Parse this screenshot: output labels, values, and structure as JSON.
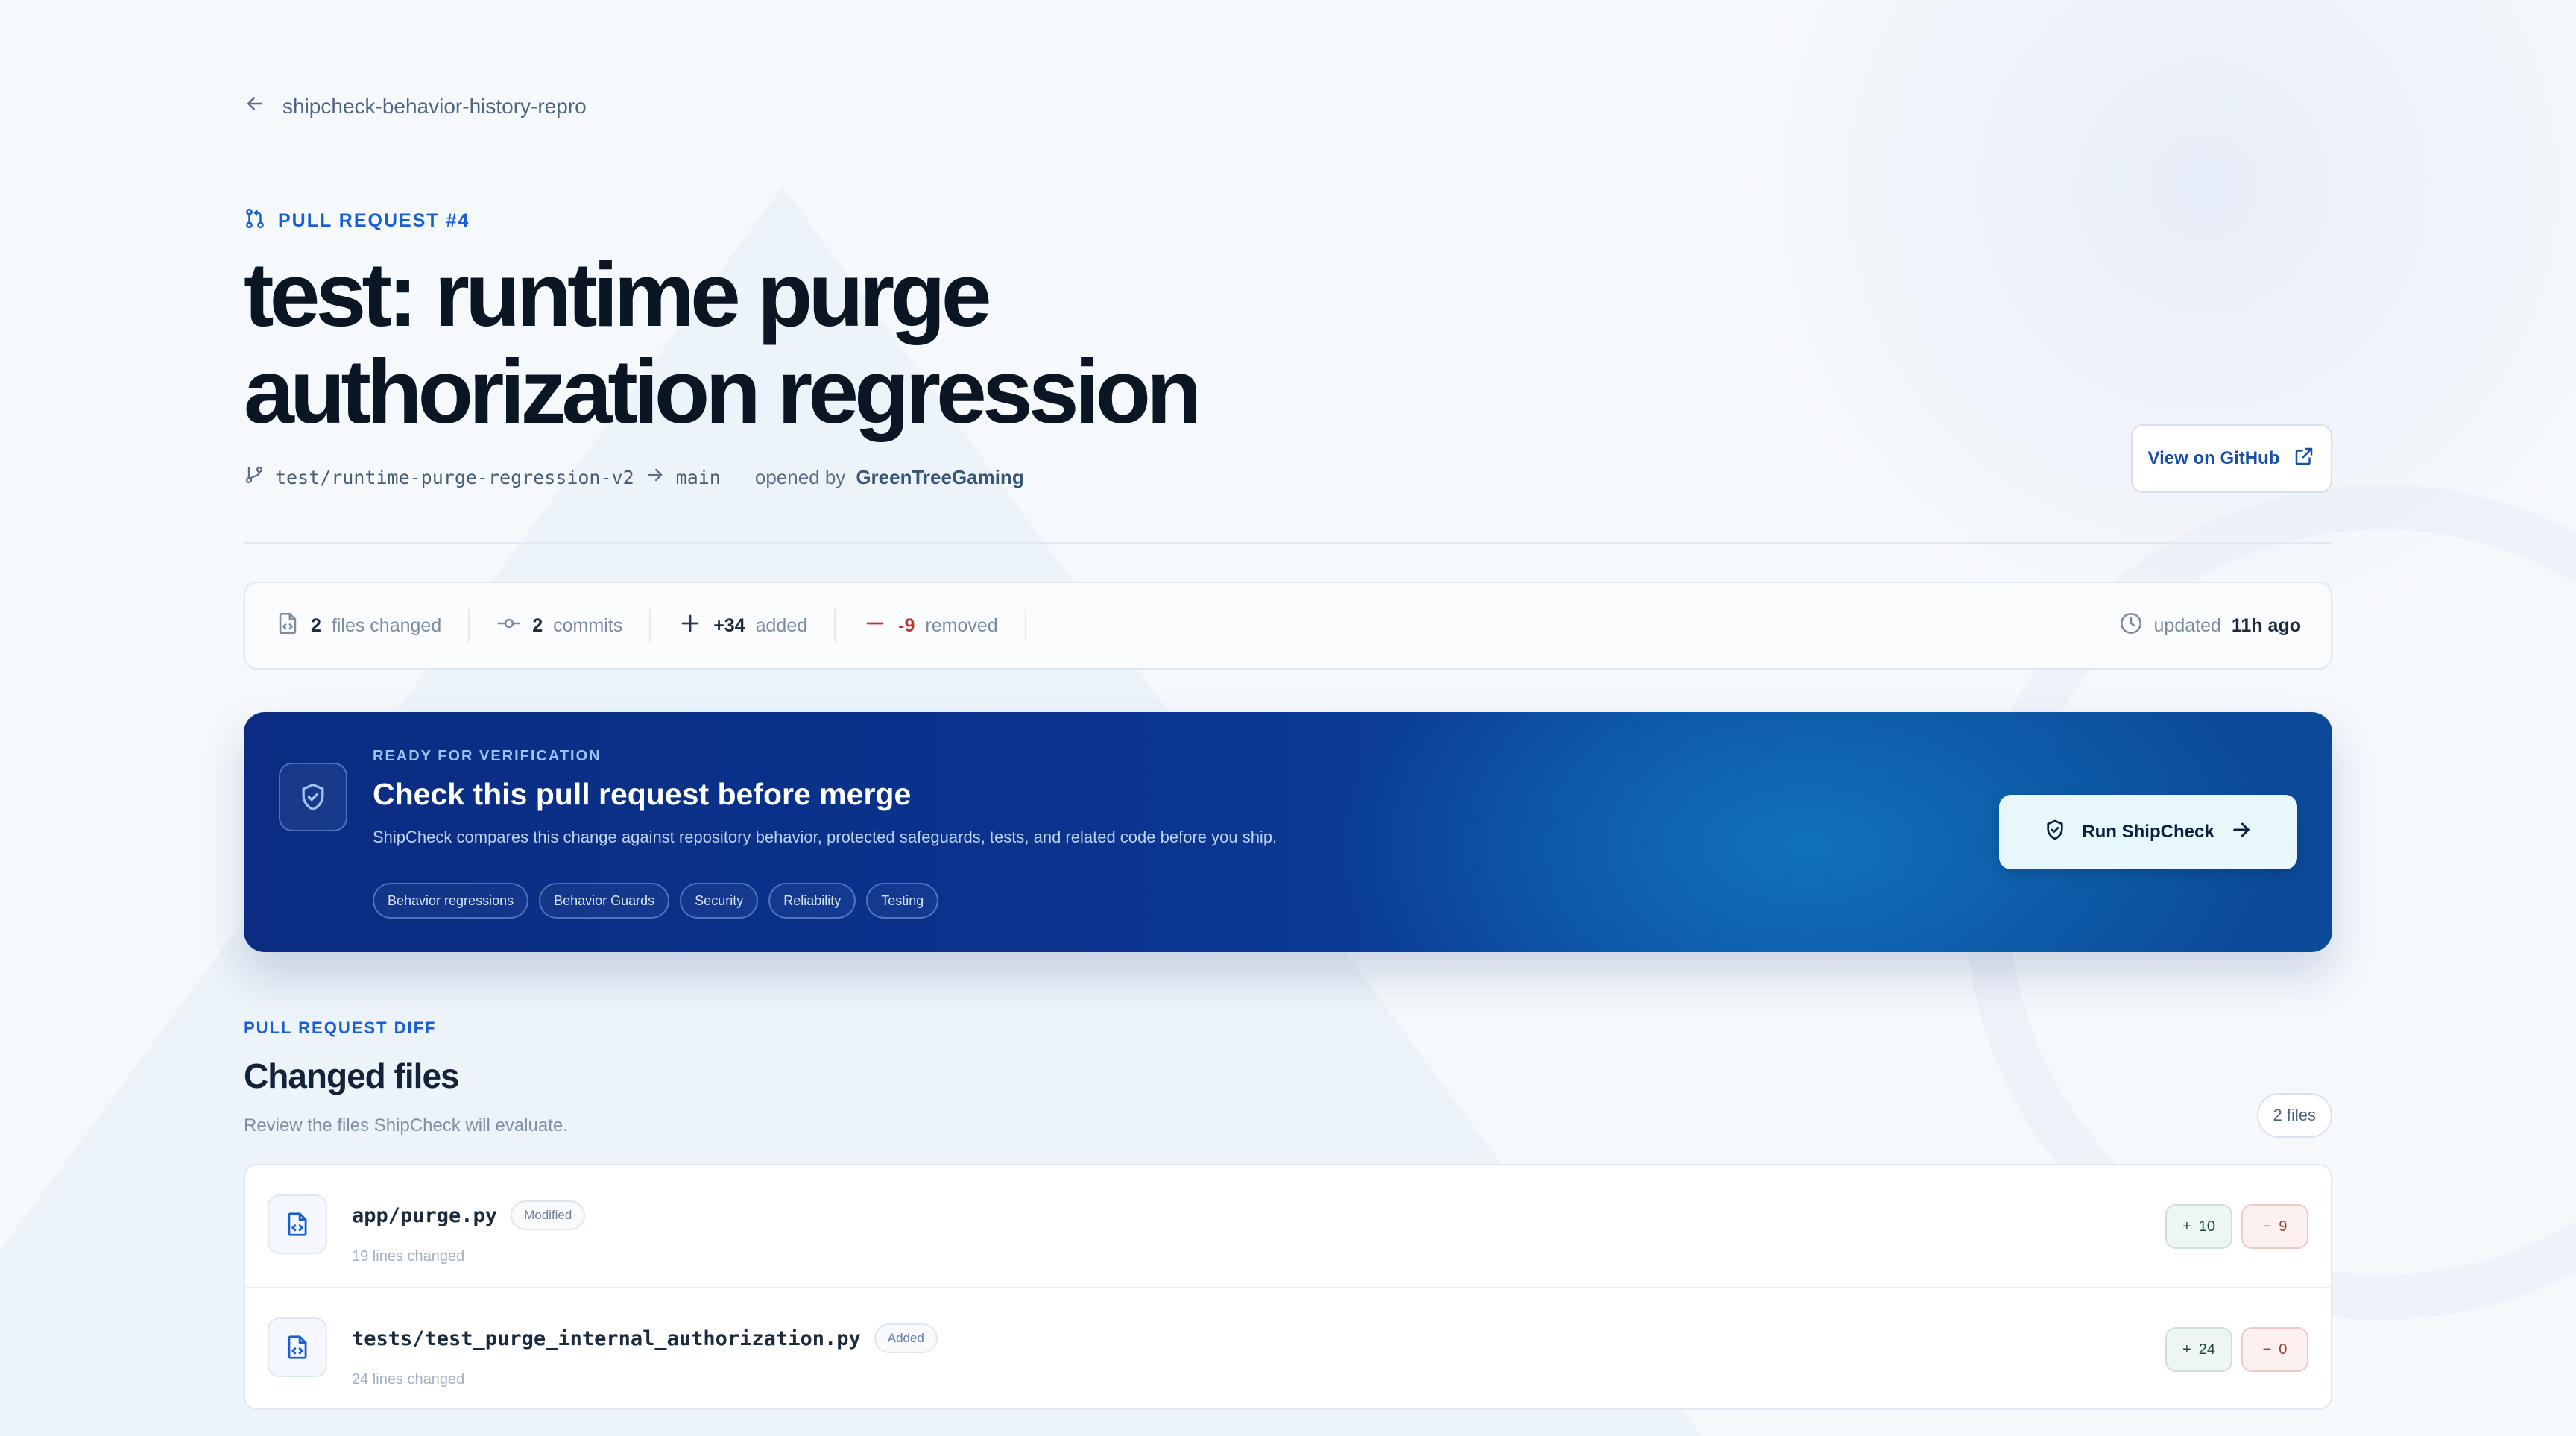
{
  "back_link": {
    "label": "shipcheck-behavior-history-repro",
    "icon": "arrow-left-icon"
  },
  "pr": {
    "eyebrow": "PULL REQUEST #4",
    "title": "test: runtime purge authorization regression",
    "source_branch": "test/runtime-purge-regression-v2",
    "target_branch": "main",
    "opened_by_label": "opened by",
    "author": "GreenTreeGaming",
    "view_github_label": "View on GitHub"
  },
  "stats": {
    "files_count": "2",
    "files_label": "files changed",
    "commits_count": "2",
    "commits_label": "commits",
    "added_count": "+34",
    "added_label": "added",
    "removed_count": "-9",
    "removed_label": "removed",
    "updated_label": "updated",
    "updated_value": "11h ago"
  },
  "banner": {
    "kicker": "READY FOR VERIFICATION",
    "title": "Check this pull request before merge",
    "description": "ShipCheck compares this change against repository behavior, protected safeguards, tests, and related code before you ship.",
    "chips": [
      "Behavior regressions",
      "Behavior Guards",
      "Security",
      "Reliability",
      "Testing"
    ],
    "run_button_label": "Run ShipCheck"
  },
  "diff": {
    "eyebrow": "PULL REQUEST DIFF",
    "title": "Changed files",
    "subtitle": "Review the files ShipCheck will evaluate.",
    "count_label": "2 files",
    "files": [
      {
        "path": "app/purge.py",
        "status": "Modified",
        "lines": "19 lines changed",
        "added": "10",
        "removed": "9"
      },
      {
        "path": "tests/test_purge_internal_authorization.py",
        "status": "Added",
        "lines": "24 lines changed",
        "added": "24",
        "removed": "0"
      }
    ]
  },
  "colors": {
    "accent": "#1a5fd1",
    "banner_dark": "#0b2c82",
    "banner_light": "#1178be",
    "removed_red": "#c0392b"
  }
}
